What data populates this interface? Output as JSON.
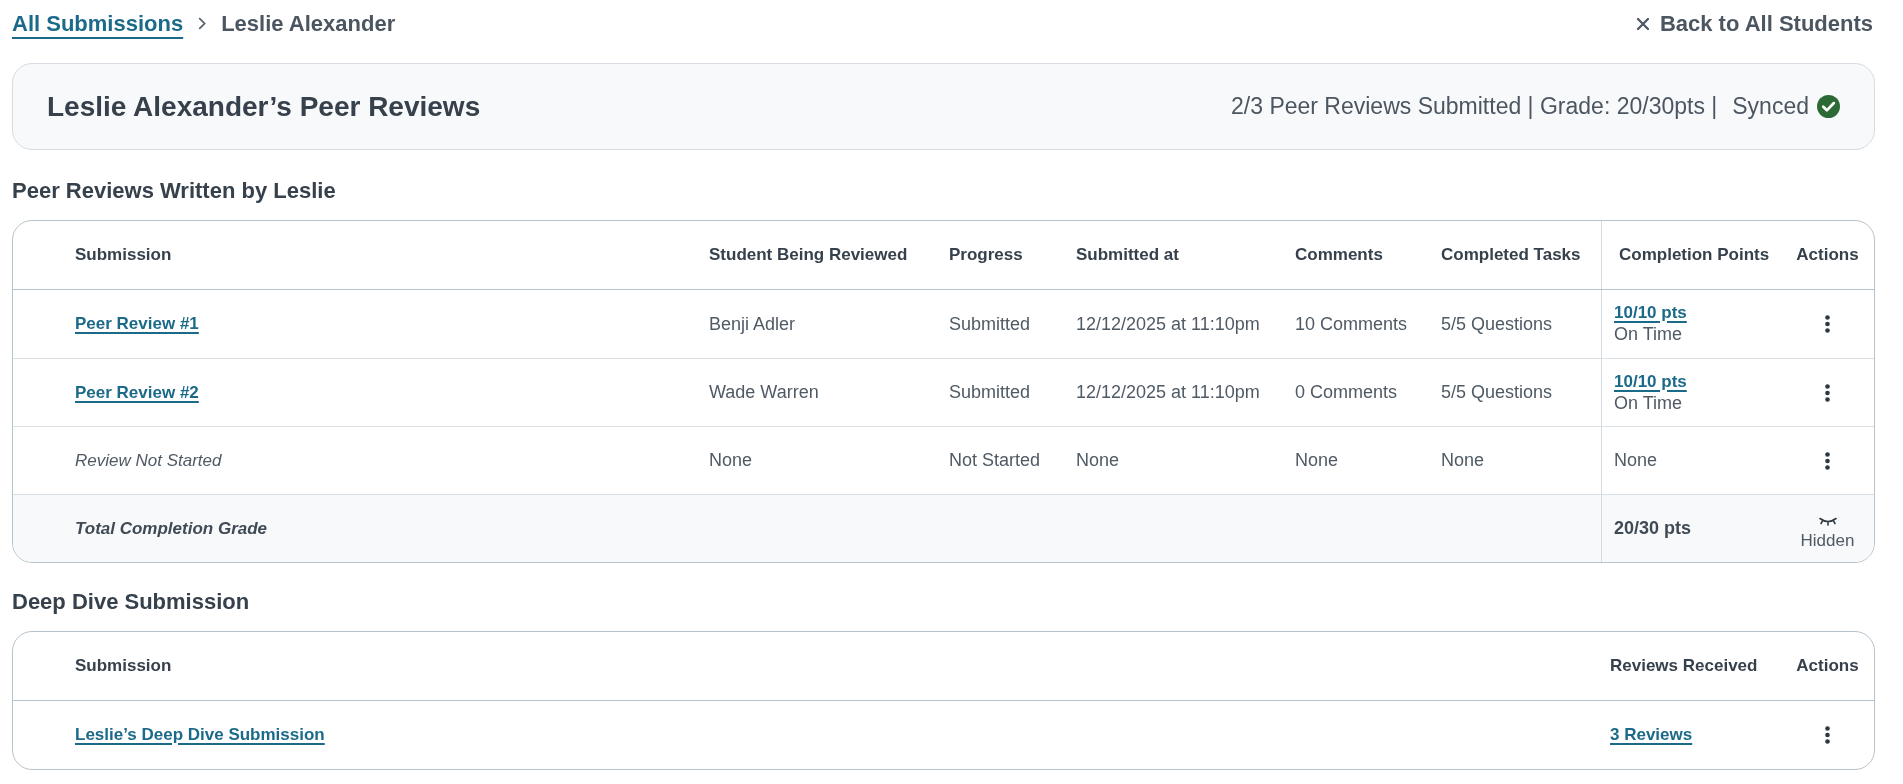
{
  "breadcrumb": [
    {
      "label": "All Submissions",
      "kind": "link"
    },
    {
      "label": "Leslie Alexander",
      "kind": "current"
    }
  ],
  "back_link": {
    "label": "Back to All Students"
  },
  "summary": {
    "title": "Leslie Alexander’s Peer Reviews",
    "stats": "2/3 Peer Reviews Submitted | Grade: 20/30pts |",
    "sync_status": "Synced"
  },
  "peer_reviews": {
    "title": "Peer Reviews Written by Leslie",
    "columns": [
      "Submission",
      "Student Being Reviewed",
      "Progress",
      "Submitted at",
      "Comments",
      "Completed Tasks",
      "Completion Points",
      "Actions"
    ],
    "rows": [
      {
        "submission": {
          "label": "Peer Review #1",
          "kind": "link"
        },
        "student": "Benji Adler",
        "progress": "Submitted",
        "submitted_at": "12/12/2025 at 11:10pm",
        "comments": "10 Comments",
        "completed_tasks": "5/5 Questions",
        "completion_points": {
          "label": "10/10 pts",
          "kind": "link",
          "note": "On Time"
        }
      },
      {
        "submission": {
          "label": "Peer Review #2",
          "kind": "link"
        },
        "student": "Wade Warren",
        "progress": "Submitted",
        "submitted_at": "12/12/2025 at 11:10pm",
        "comments": "0 Comments",
        "completed_tasks": "5/5 Questions",
        "completion_points": {
          "label": "10/10 pts",
          "kind": "link",
          "note": "On Time"
        }
      },
      {
        "submission": {
          "label": "Review Not Started",
          "kind": "placeholder"
        },
        "student": "None",
        "progress": "Not Started",
        "submitted_at": "None",
        "comments": "None",
        "completed_tasks": "None",
        "completion_points": {
          "label": "None",
          "kind": "text"
        }
      }
    ],
    "total": {
      "label": "Total Completion Grade",
      "points": "20/30 pts",
      "visibility": {
        "label": "Hidden",
        "hidden": true
      }
    }
  },
  "deep_dive": {
    "title": "Deep Dive Submission",
    "columns": [
      "Submission",
      "Reviews Received",
      "Actions"
    ],
    "rows": [
      {
        "submission": {
          "label": "Leslie’s Deep Dive Submission",
          "kind": "link"
        },
        "reviews_received": {
          "label": "3 Reviews",
          "kind": "link"
        }
      }
    ]
  }
}
